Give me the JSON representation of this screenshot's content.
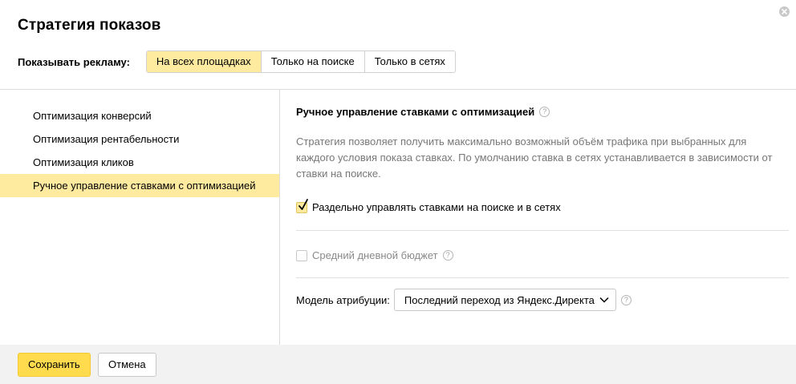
{
  "dialog": {
    "title": "Стратегия показов"
  },
  "placement": {
    "label": "Показывать рекламу:",
    "options": [
      "На всех площадках",
      "Только на поиске",
      "Только в сетях"
    ],
    "selected": "На всех площадках"
  },
  "strategies": {
    "items": [
      "Оптимизация конверсий",
      "Оптимизация рентабельности",
      "Оптимизация кликов",
      "Ручное управление ставками с оптимизацией"
    ],
    "selected": "Ручное управление ставками с оптимизацией"
  },
  "details": {
    "title": "Ручное управление ставками с оптимизацией",
    "description": "Стратегия позволяет получить максимально возможный объём трафика при выбранных для каждого условия показа ставках. По умолчанию ставка в сетях устанавливается в зависимости от ставки на поиске.",
    "separate_bids": {
      "label": "Раздельно управлять ставками на поиске и в сетях",
      "checked": true
    },
    "daily_budget": {
      "label": "Средний дневной бюджет",
      "checked": false,
      "disabled": true
    },
    "attribution": {
      "label": "Модель атрибуции:",
      "value": "Последний переход из Яндекс.Директа"
    }
  },
  "footer": {
    "save_label": "Сохранить",
    "cancel_label": "Отмена"
  },
  "icons": {
    "close": "close-icon",
    "help": "question-circle-icon",
    "checkmark": "checkmark-icon",
    "dropdown": "chevron-down-icon"
  },
  "colors": {
    "accent_selected_bg": "#ffeba0",
    "primary_button": "#ffdb4d",
    "footer_bg": "#f2f2f2",
    "description_text": "#777777"
  }
}
